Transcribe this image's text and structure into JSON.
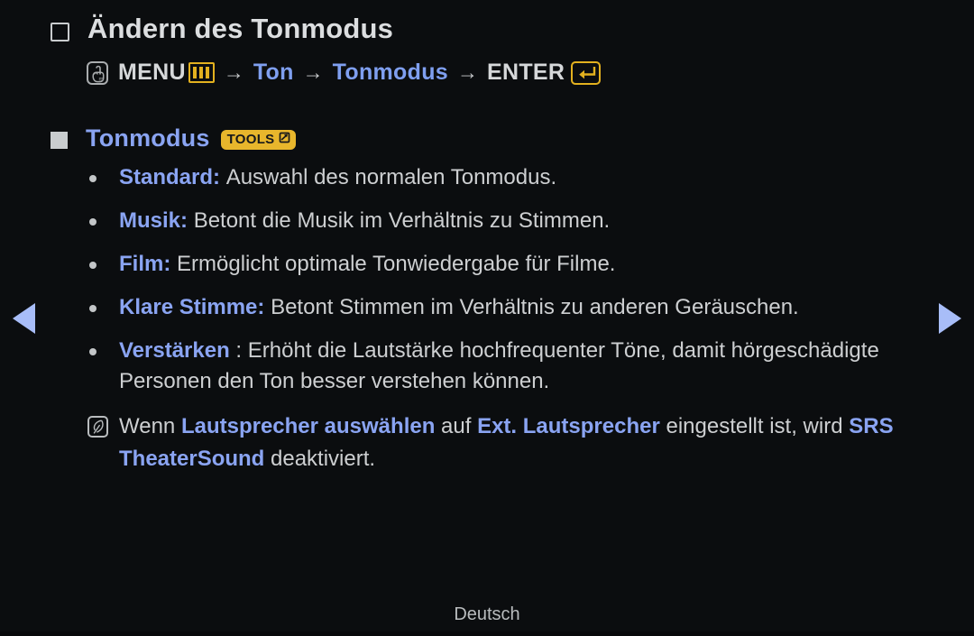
{
  "page": {
    "background_color": "#0b0d0f",
    "text_color": "#cdcfd1",
    "accent_blue": "#8aa4f2",
    "accent_gold": "#e3b11f",
    "footer_language": "Deutsch"
  },
  "title": {
    "bullet_icon": "square-outline-icon",
    "text": "Ändern des Tonmodus"
  },
  "menu_path": {
    "hand_icon": "hand-pointer-icon",
    "menu_label": "MENU",
    "menu_icon": "menu-bars-icon",
    "arrow1": "→",
    "item1": "Ton",
    "arrow2": "→",
    "item2": "Tonmodus",
    "arrow3": "→",
    "enter_label": "ENTER",
    "enter_icon": "enter-key-icon"
  },
  "section": {
    "bullet_icon": "square-filled-icon",
    "heading": "Tonmodus",
    "tools_badge": {
      "label": "TOOLS",
      "icon": "tools-arrow-icon"
    }
  },
  "options": [
    {
      "term": "Standard",
      "separator": ": ",
      "description": "Auswahl des normalen Tonmodus."
    },
    {
      "term": "Musik",
      "separator": ": ",
      "description": "Betont die Musik im Verhältnis zu Stimmen."
    },
    {
      "term": "Film",
      "separator": ": ",
      "description": "Ermöglicht optimale Tonwiedergabe für Filme."
    },
    {
      "term": "Klare Stimme",
      "separator": ": ",
      "description": "Betont Stimmen im Verhältnis zu anderen Geräuschen."
    },
    {
      "term": "Verstärken",
      "separator": " : ",
      "description": "Erhöht die Lautstärke hochfrequenter Töne, damit hörgeschädigte Personen den Ton besser verstehen können."
    }
  ],
  "note": {
    "icon": "note-pencil-icon",
    "part1": "Wenn ",
    "term1": "Lautsprecher auswählen",
    "part2": " auf ",
    "term2": "Ext. Lautsprecher",
    "part3": " eingestellt ist, wird ",
    "term3": "SRS TheaterSound",
    "part4": " deaktiviert."
  },
  "navigation": {
    "previous_icon": "triangle-left-icon",
    "next_icon": "triangle-right-icon"
  },
  "footer": {
    "language": "Deutsch"
  }
}
